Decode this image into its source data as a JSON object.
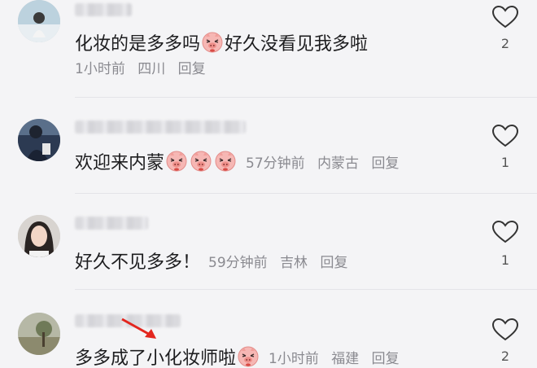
{
  "comments": [
    {
      "content_before": "化妆的是多多吗",
      "content_after": "好久没看见我多啦",
      "emoji_count": 1,
      "time": "1小时前",
      "location": "四川",
      "reply": "回复",
      "likes": "2",
      "username_visible": false
    },
    {
      "content_before": "欢迎来内蒙",
      "content_after": "",
      "emoji_count": 3,
      "time": "57分钟前",
      "location": "内蒙古",
      "reply": "回复",
      "likes": "1",
      "username_visible": false
    },
    {
      "content_before": "好久不见多多！",
      "content_after": "",
      "emoji_count": 0,
      "time": "59分钟前",
      "location": "吉林",
      "reply": "回复",
      "likes": "1",
      "username_visible": false
    },
    {
      "content_before": "多多成了小化妆师啦",
      "content_after": "",
      "emoji_count": 1,
      "time": "1小时前",
      "location": "福建",
      "reply": "回复",
      "likes": "2",
      "username_visible": false
    }
  ],
  "colors": {
    "background": "#f4f4f6",
    "text": "#1d1d1f",
    "meta": "#8a8a90",
    "arrow": "#e3261e"
  },
  "icons": {
    "like": "heart-outline-icon",
    "emoji": "pig-face-emoji-icon",
    "annotation": "red-arrow-icon"
  }
}
